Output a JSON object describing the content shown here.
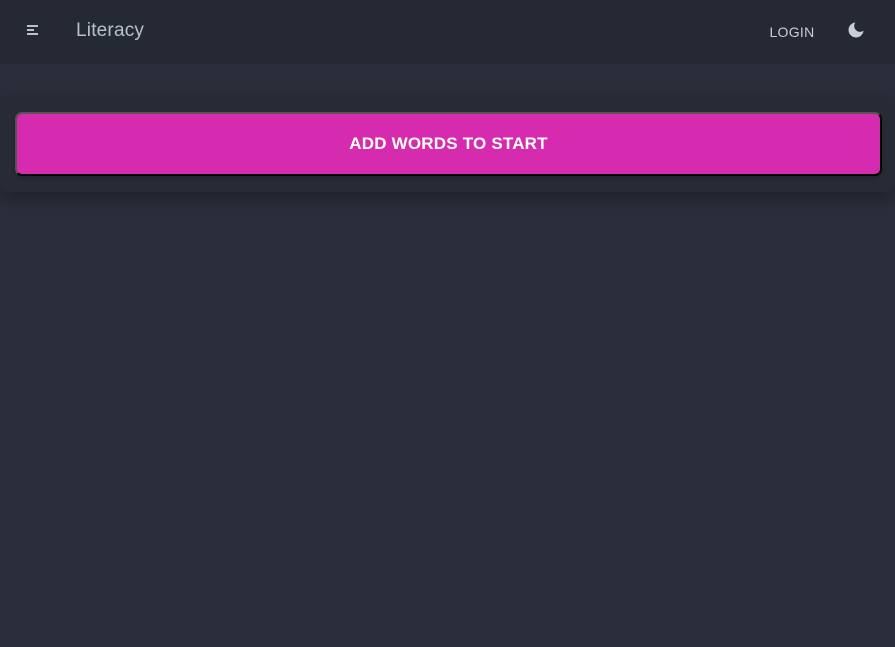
{
  "header": {
    "menu_icon": "menu-icon",
    "title": "Literacy",
    "login_label": "LOGIN",
    "theme_icon": "moon-icon"
  },
  "main": {
    "start_button_label": "ADD WORDS TO START"
  },
  "colors": {
    "background": "#2a2e3a",
    "topbar": "#252934",
    "accent": "#d62aaf",
    "text_muted": "#b9c0d0"
  }
}
